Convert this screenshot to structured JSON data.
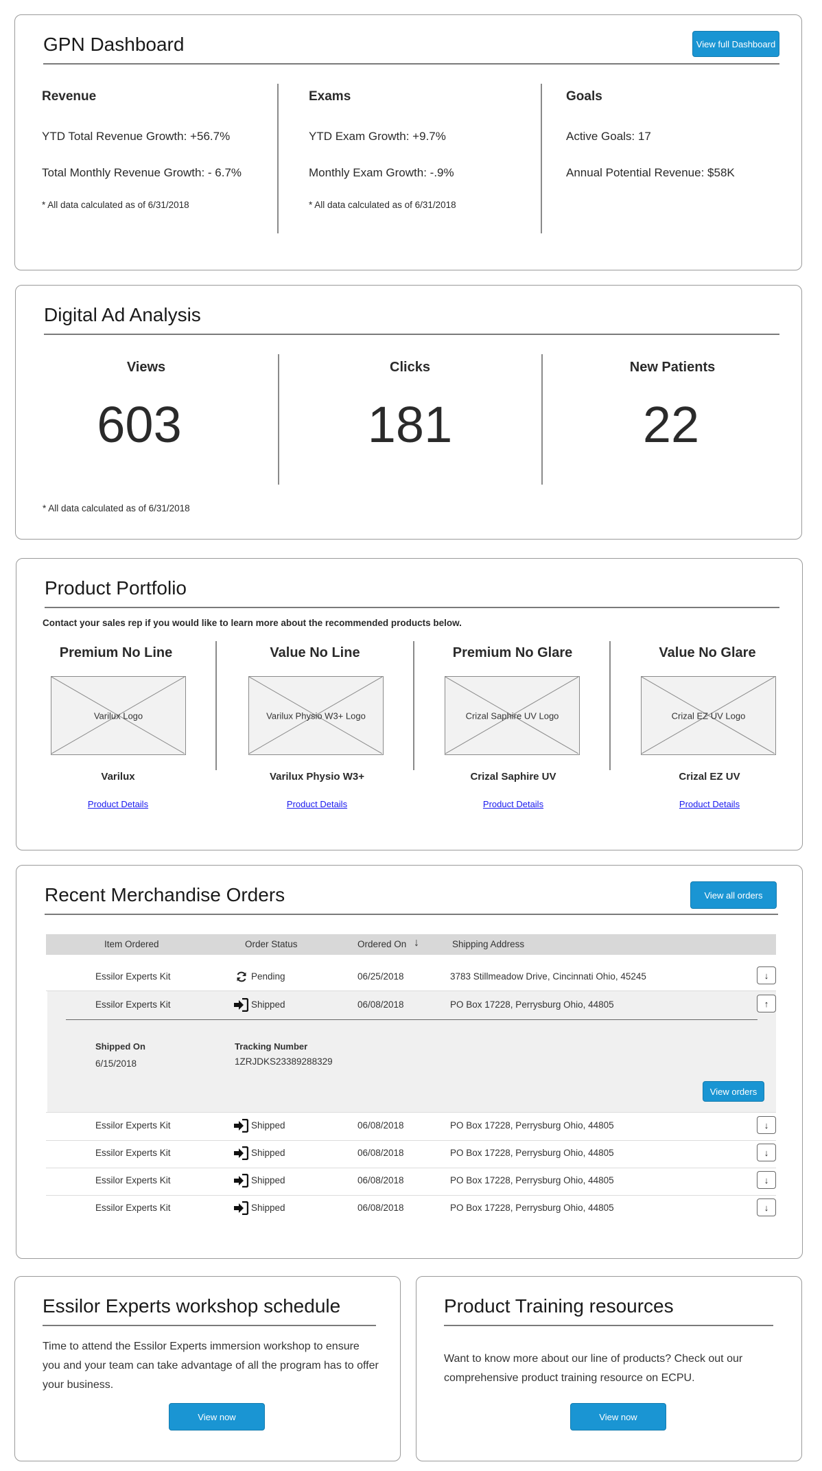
{
  "gpn": {
    "title": "GPN Dashboard",
    "view_full_label": "View full Dashboard",
    "revenue": {
      "heading": "Revenue",
      "ytd": "YTD Total Revenue Growth:  +56.7%",
      "monthly": "Total Monthly Revenue Growth:  - 6.7%",
      "note": "* All data calculated as of 6/31/2018"
    },
    "exams": {
      "heading": "Exams",
      "ytd": "YTD Exam Growth:  +9.7%",
      "monthly": "Monthly Exam Growth:  -.9%",
      "note": "* All data calculated as of 6/31/2018"
    },
    "goals": {
      "heading": "Goals",
      "active": "Active Goals:  17",
      "potential": "Annual Potential Revenue:  $58K"
    }
  },
  "ads": {
    "title": "Digital Ad Analysis",
    "views_label": "Views",
    "views_value": "603",
    "clicks_label": "Clicks",
    "clicks_value": "181",
    "patients_label": "New Patients",
    "patients_value": "22",
    "note": "* All data calculated as of 6/31/2018"
  },
  "portfolio": {
    "title": "Product Portfolio",
    "subtitle": "Contact your sales rep if you would like to learn more about the recommended products below.",
    "products": [
      {
        "category": "Premium No Line",
        "logo": "Varilux Logo",
        "name": "Varilux",
        "link": "Product Details"
      },
      {
        "category": "Value No Line",
        "logo": "Varilux Physio W3+  Logo",
        "name": "Varilux Physio W3+",
        "link": "Product Details"
      },
      {
        "category": "Premium No Glare",
        "logo": "Crizal Saphire UV  Logo",
        "name": "Crizal Saphire UV",
        "link": "Product Details"
      },
      {
        "category": "Value No Glare",
        "logo": "Crizal EZ UV  Logo",
        "name": "Crizal EZ UV",
        "link": "Product Details"
      }
    ]
  },
  "orders": {
    "title": "Recent Merchandise Orders",
    "view_all_label": "View all orders",
    "columns": {
      "item": "Item Ordered",
      "status": "Order Status",
      "ordered_on": "Ordered On",
      "address": "Shipping Address"
    },
    "rows": [
      {
        "item": "Essilor Experts Kit",
        "status": "Pending",
        "date": "06/25/2018",
        "address": "3783 Stillmeadow Drive, Cincinnati Ohio, 45245",
        "toggle": "↓"
      },
      {
        "item": "Essilor Experts Kit",
        "status": "Shipped",
        "date": "06/08/2018",
        "address": "PO Box 17228, Perrysburg Ohio, 44805",
        "toggle": "↑"
      },
      {
        "item": "Essilor Experts Kit",
        "status": "Shipped",
        "date": "06/08/2018",
        "address": "PO Box 17228, Perrysburg Ohio, 44805",
        "toggle": "↓"
      },
      {
        "item": "Essilor Experts Kit",
        "status": "Shipped",
        "date": "06/08/2018",
        "address": "PO Box 17228, Perrysburg Ohio, 44805",
        "toggle": "↓"
      },
      {
        "item": "Essilor Experts Kit",
        "status": "Shipped",
        "date": "06/08/2018",
        "address": "PO Box 17228, Perrysburg Ohio, 44805",
        "toggle": "↓"
      },
      {
        "item": "Essilor Experts Kit",
        "status": "Shipped",
        "date": "06/08/2018",
        "address": "PO Box 17228, Perrysburg Ohio, 44805",
        "toggle": "↓"
      }
    ],
    "expanded": {
      "shipped_on_label": "Shipped On",
      "shipped_on_value": "6/15/2018",
      "tracking_label": "Tracking Number",
      "tracking_value": "1ZRJDKS23389288329",
      "view_orders_label": "View orders"
    }
  },
  "workshop": {
    "title": "Essilor Experts workshop schedule",
    "body": "Time to attend the Essilor Experts immersion workshop to ensure you and your team can take advantage of all the program has to offer your business.",
    "button": "View now"
  },
  "training": {
    "title": "Product Training resources",
    "body": "Want to know more about our line of products? Check out our comprehensive product training resource on ECPU.",
    "button": "View now"
  },
  "colors": {
    "accent": "#1a95d3",
    "link": "#1a1aee",
    "table_header": "#d8d8d8"
  }
}
